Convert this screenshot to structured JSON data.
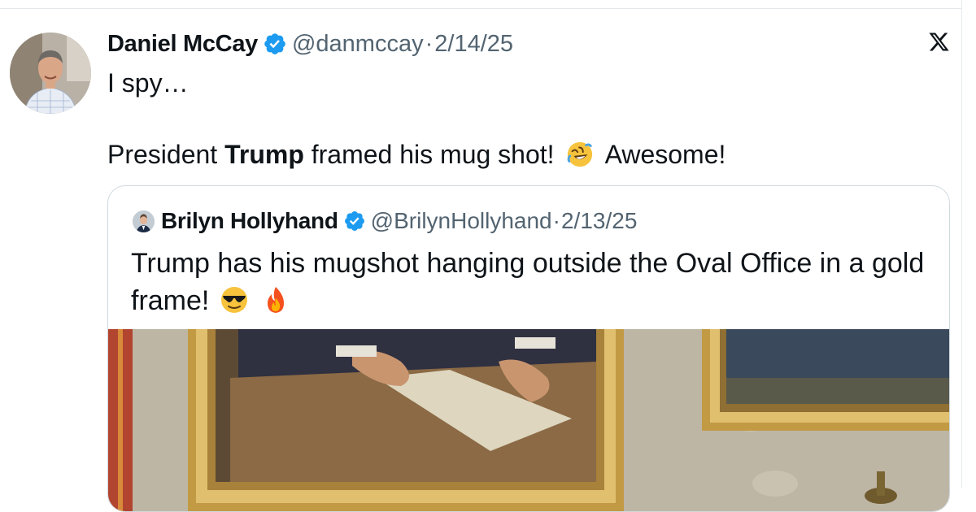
{
  "tweet": {
    "author_name": "Daniel McCay",
    "handle": "@danmccay",
    "separator": "·",
    "date": "2/14/25",
    "line1": "I spy…",
    "line2_prefix": "President ",
    "line2_bold": "Trump",
    "line2_middle": " framed his mug shot!",
    "line2_suffix": "Awesome!",
    "emoji": "rolling-on-floor-laughing-emoji",
    "avatar": "avatar-photo",
    "verified_icon": "verified-badge-icon",
    "logo_icon": "x-logo-icon"
  },
  "quote": {
    "author_name": "Brilyn Hollyhand",
    "handle": "@BrilynHollyhand",
    "separator": "·",
    "date": "2/13/25",
    "text": "Trump has his mugshot hanging outside the Oval Office in a gold frame!",
    "emojis": [
      "sunglasses-emoji",
      "fire-emoji"
    ],
    "media": "photo-of-gold-framed-paintings"
  },
  "colors": {
    "text": "#0f1419",
    "secondary_text": "#536471",
    "verified_blue": "#1d9bf0",
    "border": "#cfd9de",
    "frame_gold": "#c9a24a"
  }
}
